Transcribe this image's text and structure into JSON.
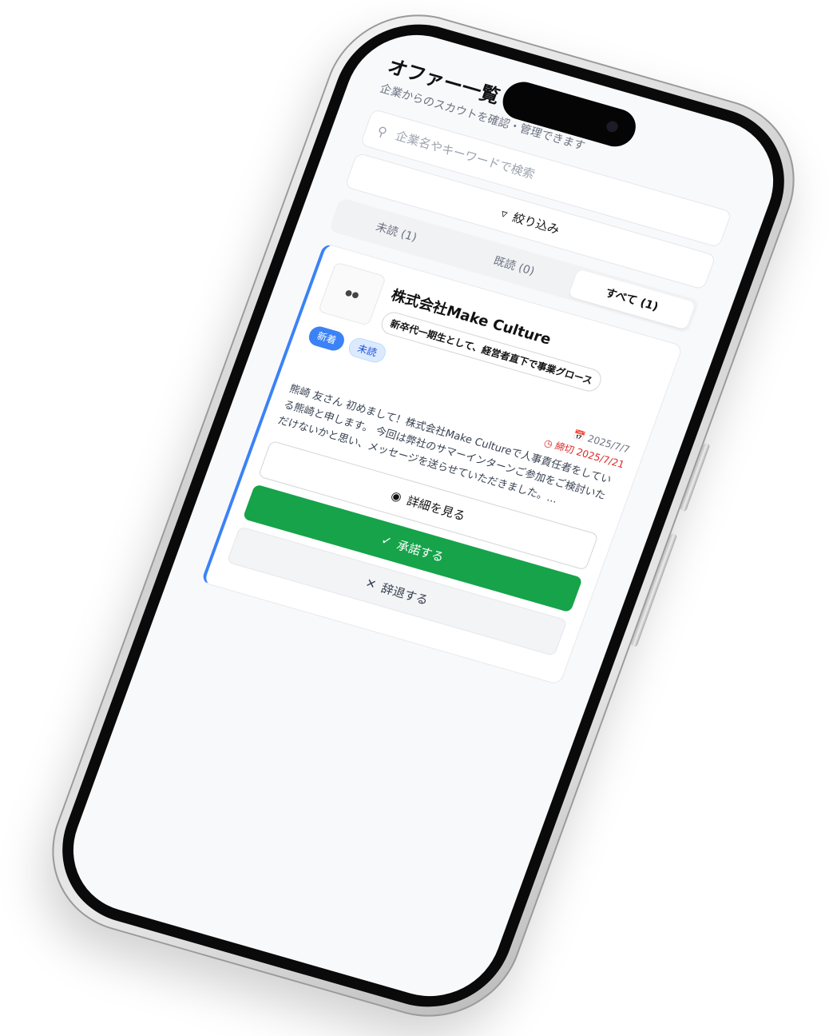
{
  "header": {
    "title": "オファー一覧",
    "subtitle": "企業からのスカウトを確認・管理できます"
  },
  "search": {
    "placeholder": "企業名やキーワードで検索",
    "value": ""
  },
  "filter": {
    "label": "絞り込み"
  },
  "tabs": [
    {
      "label": "未読 (1)",
      "active": false
    },
    {
      "label": "既読 (0)",
      "active": false
    },
    {
      "label": "すべて (1)",
      "active": true
    }
  ],
  "offer": {
    "logo_text": "",
    "company": "株式会社Make Culture",
    "title": "新卒代一期生として、経営者直下で事業グロース",
    "badges": {
      "new": "新着",
      "unread": "未読"
    },
    "date": "2025/7/7",
    "deadline": "締切 2025/7/21",
    "message": "熊崎 友さん 初めまして！株式会社Make Cultureで人事責任者をしている熊崎と申します。 今回は弊社のサマーインターンご参加をご検討いただけないかと思い、メッセージを送らせていただきました。...",
    "detail_label": "詳細を見る",
    "accept_label": "承諾する",
    "decline_label": "辞退する"
  },
  "colors": {
    "accent": "#3b82f6",
    "accept": "#16a34a",
    "deadline": "#dc2626"
  }
}
